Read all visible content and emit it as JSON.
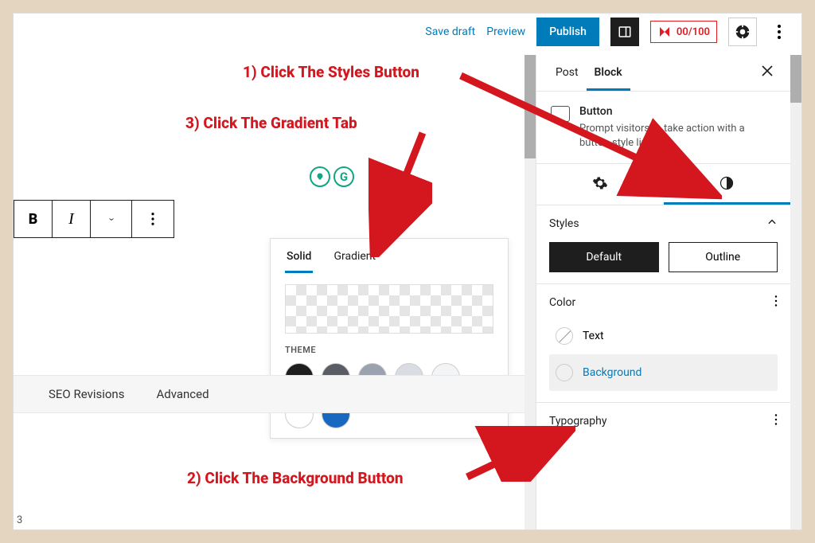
{
  "topbar": {
    "save_draft": "Save draft",
    "preview": "Preview",
    "publish": "Publish",
    "seo_score": "00/100"
  },
  "annotations": {
    "step1": "1) Click The Styles Button",
    "step2": "2) Click The Background Button",
    "step3": "3) Click The Gradient Tab"
  },
  "format": {
    "bold": "B",
    "italic": "I"
  },
  "color_popover": {
    "tab_solid": "Solid",
    "tab_gradient": "Gradient",
    "theme_label": "THEME",
    "theme_colors": [
      "#1e1e1e",
      "#5a5d63",
      "#9ca1af",
      "#d9dce2",
      "#f3f4f6",
      "#ffffff",
      "#1868c1"
    ]
  },
  "lower_tabs": {
    "a": "SEO Revisions",
    "b": "Advanced"
  },
  "lower_number": "3",
  "sidebar": {
    "tab_post": "Post",
    "tab_block": "Block",
    "block_name": "Button",
    "block_desc": "Prompt visitors to take action with a button-style link.",
    "styles_label": "Styles",
    "style_default": "Default",
    "style_outline": "Outline",
    "color_label": "Color",
    "color_text": "Text",
    "color_background": "Background",
    "typography_label": "Typography"
  }
}
